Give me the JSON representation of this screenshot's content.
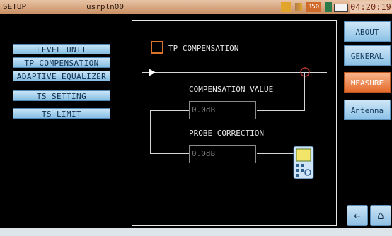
{
  "status_bar": {
    "title": "SETUP",
    "device": "usrpln00",
    "indicator": "350",
    "clock": "04:20:19"
  },
  "menu": {
    "items": [
      {
        "label": "LEVEL UNIT"
      },
      {
        "label": "TP COMPENSATION"
      },
      {
        "label": "ADAPTIVE EQUALIZER"
      },
      {
        "label": "TS SETTING"
      },
      {
        "label": "TS LIMIT"
      }
    ]
  },
  "panel": {
    "checkbox_label": "TP COMPENSATION",
    "compensation_label": "COMPENSATION VALUE",
    "compensation_value": "0.0dB",
    "probe_label": "PROBE CORRECTION",
    "probe_value": "0.0dB"
  },
  "side_nav": {
    "items": [
      {
        "label": "ABOUT"
      },
      {
        "label": "GENERAL"
      },
      {
        "label": "MEASURE"
      },
      {
        "label": "Antenna"
      }
    ],
    "active": "MEASURE"
  },
  "colors": {
    "accent": "#e56b2c",
    "button": "#8bc1e6",
    "checkbox": "#d8722c"
  }
}
